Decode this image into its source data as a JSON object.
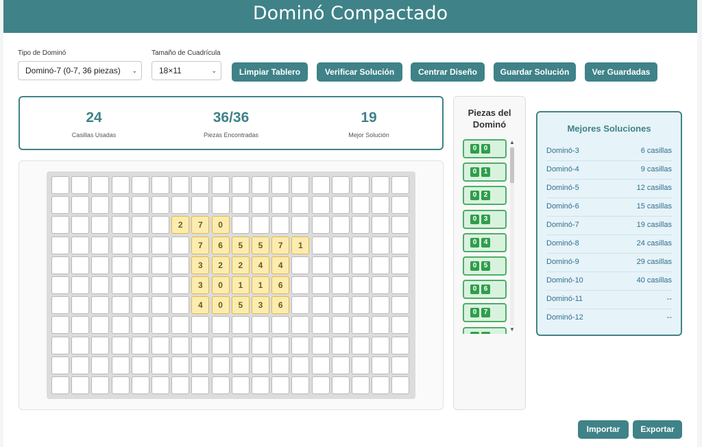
{
  "header": {
    "title": "Dominó Compactado"
  },
  "controls": {
    "domino_type_label": "Tipo de Dominó",
    "domino_type_value": "Dominó-7 (0-7, 36 piezas)",
    "grid_size_label": "Tamaño de Cuadrícula",
    "grid_size_value": "18×11"
  },
  "toolbar": {
    "clear_label": "Limpiar Tablero",
    "verify_label": "Verificar Solución",
    "center_label": "Centrar Diseño",
    "save_label": "Guardar Solución",
    "view_saved_label": "Ver Guardadas"
  },
  "stats": {
    "used": {
      "value": "24",
      "label": "Casillas Usadas"
    },
    "found": {
      "value": "36/36",
      "label": "Piezas Encontradas"
    },
    "best": {
      "value": "19",
      "label": "Mejor Solución"
    }
  },
  "board": {
    "cols": 18,
    "rows": 11,
    "filled": [
      {
        "r": 2,
        "c": 6,
        "v": "2"
      },
      {
        "r": 2,
        "c": 7,
        "v": "7"
      },
      {
        "r": 2,
        "c": 8,
        "v": "0"
      },
      {
        "r": 3,
        "c": 7,
        "v": "7"
      },
      {
        "r": 3,
        "c": 8,
        "v": "6"
      },
      {
        "r": 3,
        "c": 9,
        "v": "5"
      },
      {
        "r": 3,
        "c": 10,
        "v": "5"
      },
      {
        "r": 3,
        "c": 11,
        "v": "7"
      },
      {
        "r": 3,
        "c": 12,
        "v": "1"
      },
      {
        "r": 4,
        "c": 7,
        "v": "3"
      },
      {
        "r": 4,
        "c": 8,
        "v": "2"
      },
      {
        "r": 4,
        "c": 9,
        "v": "2"
      },
      {
        "r": 4,
        "c": 10,
        "v": "4"
      },
      {
        "r": 4,
        "c": 11,
        "v": "4"
      },
      {
        "r": 5,
        "c": 7,
        "v": "3"
      },
      {
        "r": 5,
        "c": 8,
        "v": "0"
      },
      {
        "r": 5,
        "c": 9,
        "v": "1"
      },
      {
        "r": 5,
        "c": 10,
        "v": "1"
      },
      {
        "r": 5,
        "c": 11,
        "v": "6"
      },
      {
        "r": 6,
        "c": 7,
        "v": "4"
      },
      {
        "r": 6,
        "c": 8,
        "v": "0"
      },
      {
        "r": 6,
        "c": 9,
        "v": "5"
      },
      {
        "r": 6,
        "c": 10,
        "v": "3"
      },
      {
        "r": 6,
        "c": 11,
        "v": "6"
      }
    ]
  },
  "pieces": {
    "title": "Piezas del Dominó",
    "items": [
      {
        "a": "0",
        "b": "0"
      },
      {
        "a": "0",
        "b": "1"
      },
      {
        "a": "0",
        "b": "2"
      },
      {
        "a": "0",
        "b": "3"
      },
      {
        "a": "0",
        "b": "4"
      },
      {
        "a": "0",
        "b": "5"
      },
      {
        "a": "0",
        "b": "6"
      },
      {
        "a": "0",
        "b": "7"
      },
      {
        "a": "",
        "b": ""
      }
    ]
  },
  "best": {
    "title": "Mejores Soluciones",
    "rows": [
      {
        "name": "Dominó-3",
        "value": "6 casillas"
      },
      {
        "name": "Dominó-4",
        "value": "9 casillas"
      },
      {
        "name": "Dominó-5",
        "value": "12 casillas"
      },
      {
        "name": "Dominó-6",
        "value": "15 casillas"
      },
      {
        "name": "Dominó-7",
        "value": "19 casillas"
      },
      {
        "name": "Dominó-8",
        "value": "24 casillas"
      },
      {
        "name": "Dominó-9",
        "value": "29 casillas"
      },
      {
        "name": "Dominó-10",
        "value": "40 casillas"
      },
      {
        "name": "Dominó-11",
        "value": "--"
      },
      {
        "name": "Dominó-12",
        "value": "--"
      }
    ]
  },
  "footer": {
    "import_label": "Importar",
    "export_label": "Exportar"
  }
}
